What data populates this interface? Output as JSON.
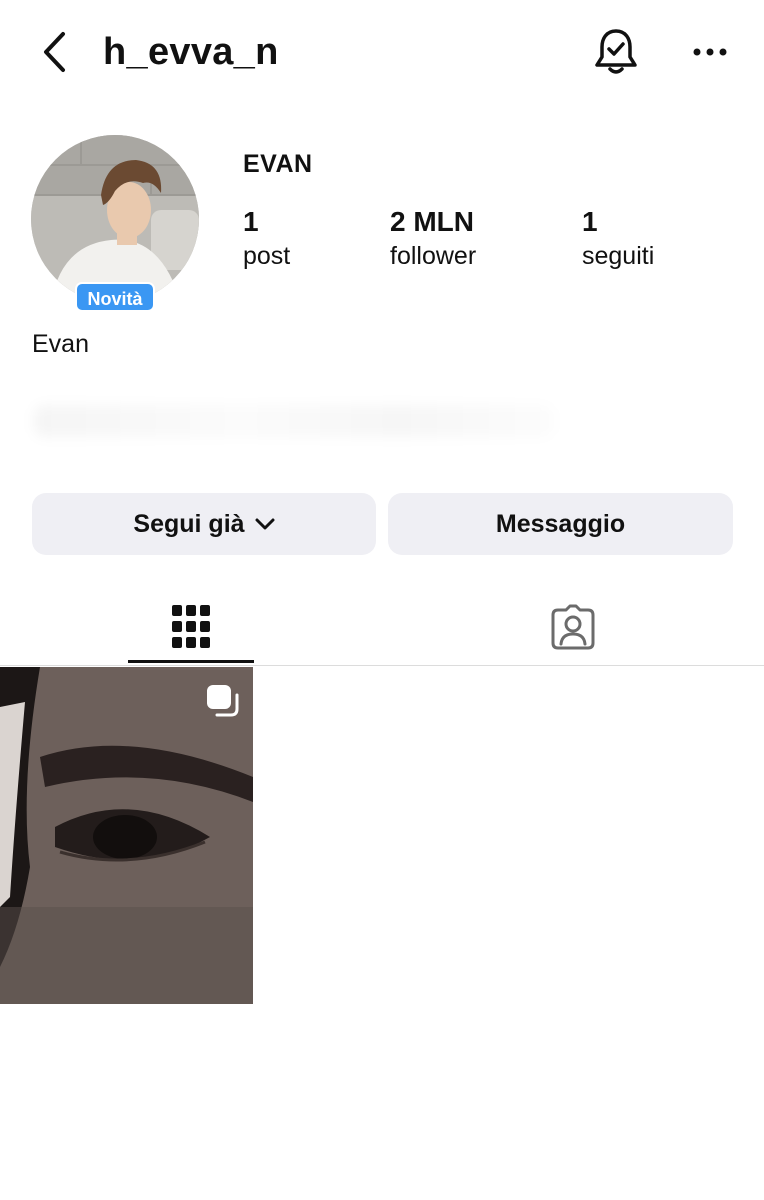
{
  "header": {
    "back_icon": "chevron-left-icon",
    "username": "h_evva_n",
    "notifications_icon": "bell-check-icon",
    "more_icon": "more-horizontal-icon"
  },
  "profile": {
    "display_name": "EVAN",
    "badge": "Novità",
    "stats": [
      {
        "value": "1",
        "label": "post"
      },
      {
        "value": "2 MLN",
        "label": "follower"
      },
      {
        "value": "1",
        "label": "seguiti"
      }
    ],
    "bio_name": "Evan"
  },
  "actions": {
    "follow_label": "Segui già",
    "follow_icon": "chevron-down-icon",
    "message_label": "Messaggio"
  },
  "tabs": [
    {
      "icon": "grid-icon",
      "active": true
    },
    {
      "icon": "tagged-person-icon",
      "active": false
    }
  ],
  "posts": [
    {
      "type": "carousel",
      "icon": "multiple-photos-icon"
    }
  ]
}
